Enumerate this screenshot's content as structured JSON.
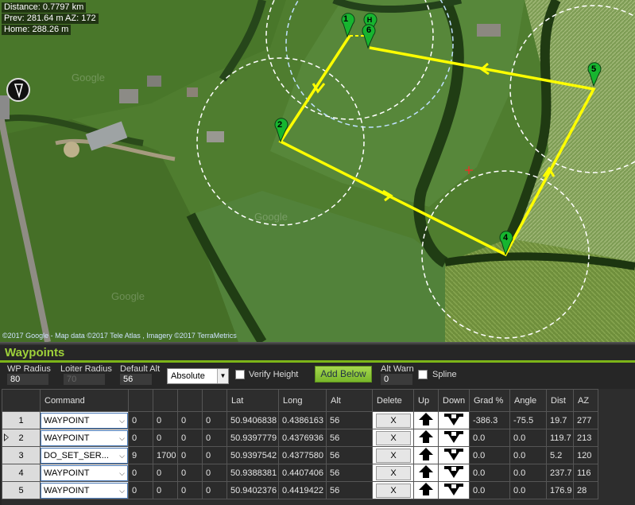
{
  "map": {
    "info": {
      "distance": "Distance: 0.7797 km",
      "prev": "Prev: 281.64 m AZ: 172",
      "home": "Home: 288.26 m"
    },
    "credits": "©2017 Google - Map data ©2017 Tele Atlas , Imagery ©2017 TerraMetrics",
    "watermark": "Google",
    "markers": [
      {
        "label": "1",
        "icon": "green-map-pin-icon"
      },
      {
        "label": "H",
        "icon": "home-pin-icon"
      },
      {
        "label": "6",
        "icon": "green-map-pin-icon"
      },
      {
        "label": "2",
        "icon": "green-map-pin-icon"
      },
      {
        "label": "4",
        "icon": "green-map-pin-icon"
      },
      {
        "label": "5",
        "icon": "green-map-pin-icon"
      }
    ],
    "route_color": "#ffff00",
    "circle_color": "#ffffff",
    "center_marker": "red-cross-icon",
    "compass_icon": "compass-icon"
  },
  "panel": {
    "title": "Waypoints",
    "accent": "#7cb518",
    "wp_radius_label": "WP Radius",
    "wp_radius_value": "80",
    "loiter_radius_label": "Loiter Radius",
    "loiter_radius_value": "70",
    "default_alt_label": "Default Alt",
    "default_alt_value": "56",
    "altitude_mode": "Absolute",
    "verify_height_label": "Verify Height",
    "add_below_label": "Add Below",
    "alt_warn_label": "Alt Warn",
    "alt_warn_value": "0",
    "spline_label": "Spline"
  },
  "table": {
    "headers": [
      "",
      "Command",
      "",
      "",
      "",
      "",
      "Lat",
      "Long",
      "Alt",
      "Delete",
      "Up",
      "Down",
      "Grad %",
      "Angle",
      "Dist",
      "AZ"
    ],
    "rows": [
      {
        "num": "1",
        "command": "WAYPOINT",
        "p1": "0",
        "p2": "0",
        "p3": "0",
        "p4": "0",
        "lat": "50.9406838",
        "long": "0.4386163",
        "alt": "56",
        "delete": "X",
        "grad": "-386.3",
        "angle": "-75.5",
        "dist": "19.7",
        "az": "277"
      },
      {
        "num": "2",
        "command": "WAYPOINT",
        "p1": "0",
        "p2": "0",
        "p3": "0",
        "p4": "0",
        "lat": "50.9397779",
        "long": "0.4376936",
        "alt": "56",
        "delete": "X",
        "grad": "0.0",
        "angle": "0.0",
        "dist": "119.7",
        "az": "213"
      },
      {
        "num": "3",
        "command": "DO_SET_SER...",
        "p1": "9",
        "p2": "1700",
        "p3": "0",
        "p4": "0",
        "lat": "50.9397542",
        "long": "0.4377580",
        "alt": "56",
        "delete": "X",
        "grad": "0.0",
        "angle": "0.0",
        "dist": "5.2",
        "az": "120"
      },
      {
        "num": "4",
        "command": "WAYPOINT",
        "p1": "0",
        "p2": "0",
        "p3": "0",
        "p4": "0",
        "lat": "50.9388381",
        "long": "0.4407406",
        "alt": "56",
        "delete": "X",
        "grad": "0.0",
        "angle": "0.0",
        "dist": "237.7",
        "az": "116"
      },
      {
        "num": "5",
        "command": "WAYPOINT",
        "p1": "0",
        "p2": "0",
        "p3": "0",
        "p4": "0",
        "lat": "50.9402376",
        "long": "0.4419422",
        "alt": "56",
        "delete": "X",
        "grad": "0.0",
        "angle": "0.0",
        "dist": "176.9",
        "az": "28"
      }
    ],
    "up_icon": "up-arrow-icon",
    "down_icon": "down-arrow-icon"
  }
}
